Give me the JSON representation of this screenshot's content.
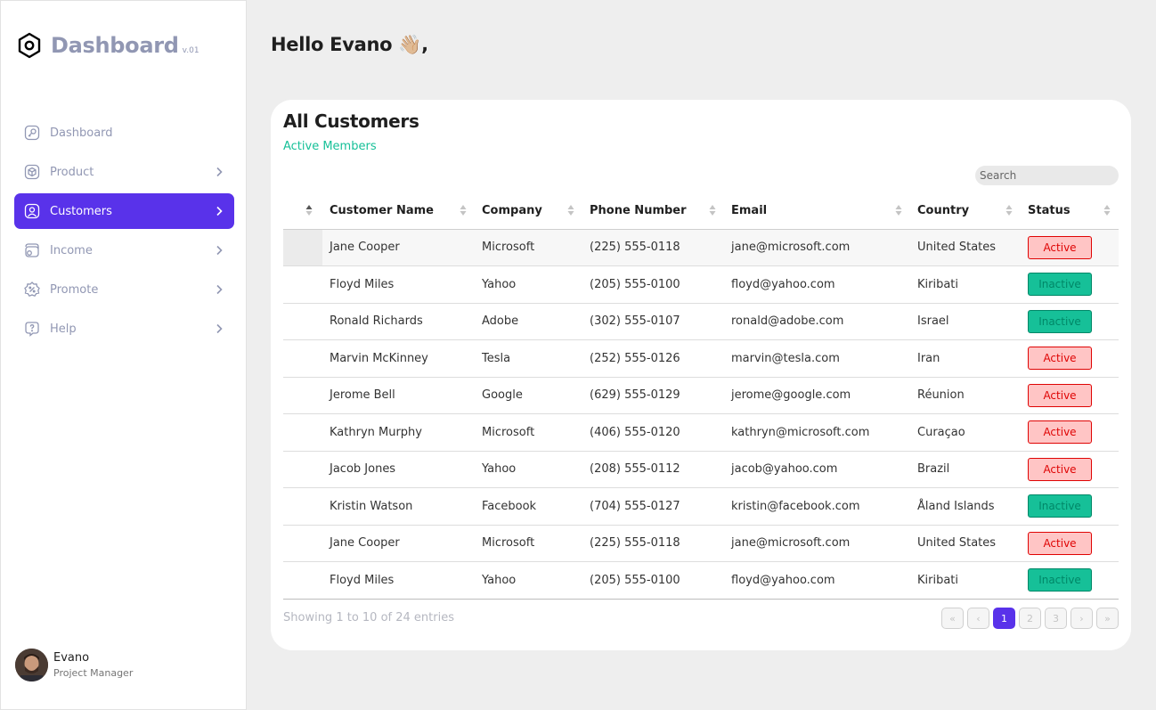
{
  "brand": {
    "title": "Dashboard",
    "version": "v.01"
  },
  "nav": [
    {
      "label": "Dashboard",
      "icon": "key-icon",
      "active": false,
      "chevron": false
    },
    {
      "label": "Product",
      "icon": "cube-icon",
      "active": false,
      "chevron": true
    },
    {
      "label": "Customers",
      "icon": "user-square-icon",
      "active": true,
      "chevron": true
    },
    {
      "label": "Income",
      "icon": "wallet-icon",
      "active": false,
      "chevron": true
    },
    {
      "label": "Promote",
      "icon": "discount-icon",
      "active": false,
      "chevron": true
    },
    {
      "label": "Help",
      "icon": "message-question-icon",
      "active": false,
      "chevron": true
    }
  ],
  "profile": {
    "name": "Evano",
    "role": "Project Manager"
  },
  "greeting": "Hello Evano 👋🏼,",
  "card": {
    "title": "All Customers",
    "subtitle": "Active Members",
    "search_placeholder": "Search"
  },
  "table": {
    "columns": [
      "",
      "Customer Name",
      "Company",
      "Phone Number",
      "Email",
      "Country",
      "Status"
    ],
    "rows": [
      {
        "name": "Jane Cooper",
        "company": "Microsoft",
        "phone": "(225) 555-0118",
        "email": "jane@microsoft.com",
        "country": "United States",
        "status": "Active"
      },
      {
        "name": "Floyd Miles",
        "company": "Yahoo",
        "phone": "(205) 555-0100",
        "email": "floyd@yahoo.com",
        "country": "Kiribati",
        "status": "Inactive"
      },
      {
        "name": "Ronald Richards",
        "company": "Adobe",
        "phone": "(302) 555-0107",
        "email": "ronald@adobe.com",
        "country": "Israel",
        "status": "Inactive"
      },
      {
        "name": "Marvin McKinney",
        "company": "Tesla",
        "phone": "(252) 555-0126",
        "email": "marvin@tesla.com",
        "country": "Iran",
        "status": "Active"
      },
      {
        "name": "Jerome Bell",
        "company": "Google",
        "phone": "(629) 555-0129",
        "email": "jerome@google.com",
        "country": "Réunion",
        "status": "Active"
      },
      {
        "name": "Kathryn Murphy",
        "company": "Microsoft",
        "phone": "(406) 555-0120",
        "email": "kathryn@microsoft.com",
        "country": "Curaçao",
        "status": "Active"
      },
      {
        "name": "Jacob Jones",
        "company": "Yahoo",
        "phone": "(208) 555-0112",
        "email": "jacob@yahoo.com",
        "country": "Brazil",
        "status": "Active"
      },
      {
        "name": "Kristin Watson",
        "company": "Facebook",
        "phone": "(704) 555-0127",
        "email": "kristin@facebook.com",
        "country": "Åland Islands",
        "status": "Inactive"
      },
      {
        "name": "Jane Cooper",
        "company": "Microsoft",
        "phone": "(225) 555-0118",
        "email": "jane@microsoft.com",
        "country": "United States",
        "status": "Active"
      },
      {
        "name": "Floyd Miles",
        "company": "Yahoo",
        "phone": "(205) 555-0100",
        "email": "floyd@yahoo.com",
        "country": "Kiribati",
        "status": "Inactive"
      }
    ]
  },
  "footer": {
    "info": "Showing 1 to 10 of 24 entries"
  },
  "pagination": [
    {
      "label": "«",
      "name": "first-page-button",
      "state": "disabled"
    },
    {
      "label": "‹",
      "name": "prev-page-button",
      "state": "disabled"
    },
    {
      "label": "1",
      "name": "page-1-button",
      "state": "current"
    },
    {
      "label": "2",
      "name": "page-2-button",
      "state": "disabled"
    },
    {
      "label": "3",
      "name": "page-3-button",
      "state": "disabled"
    },
    {
      "label": "›",
      "name": "next-page-button",
      "state": "disabled"
    },
    {
      "label": "»",
      "name": "last-page-button",
      "state": "disabled"
    }
  ],
  "colors": {
    "accent": "#5932ea",
    "active_bg": "#ffc5c5",
    "active_text": "#df0404",
    "inactive_bg": "#16c098",
    "inactive_text": "#008767"
  }
}
